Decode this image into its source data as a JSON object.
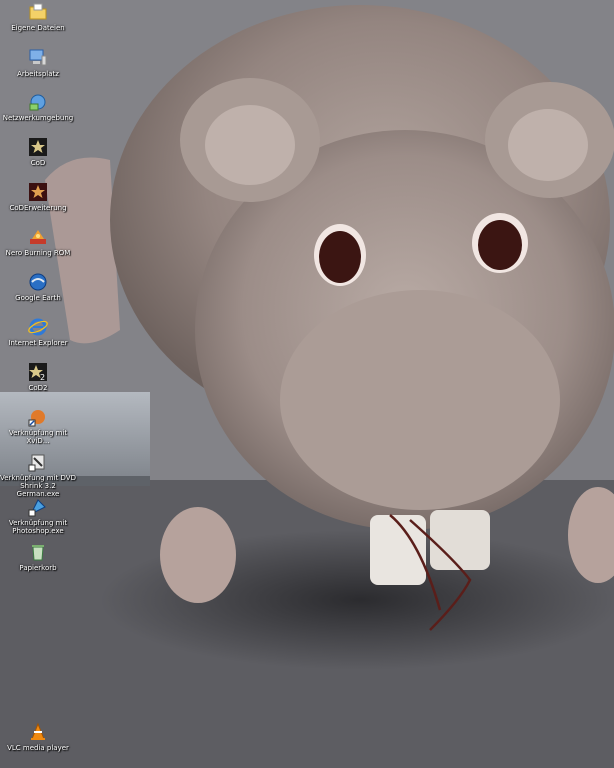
{
  "desktop": {
    "icons": [
      {
        "label": "Eigene Dateien",
        "icon": "folder-documents-icon"
      },
      {
        "label": "Arbeitsplatz",
        "icon": "my-computer-icon"
      },
      {
        "label": "Netzwerkumgebung",
        "icon": "network-icon"
      },
      {
        "label": "CoD",
        "icon": "cod-star-icon"
      },
      {
        "label": "CoDErweiterung",
        "icon": "cod-expansion-icon"
      },
      {
        "label": "Nero Burning ROM",
        "icon": "nero-icon"
      },
      {
        "label": "Google Earth",
        "icon": "google-earth-icon"
      },
      {
        "label": "Internet Explorer",
        "icon": "internet-explorer-icon"
      },
      {
        "label": "CoD2",
        "icon": "cod2-icon"
      },
      {
        "label": "Verknüpfung mit XviD...",
        "icon": "shortcut-app-icon"
      },
      {
        "label": "Verknüpfung mit DVD Shrink 3.2 German.exe",
        "icon": "dvd-shrink-icon"
      },
      {
        "label": "Verknüpfung mit Photoshop.exe",
        "icon": "photoshop-icon"
      },
      {
        "label": "Papierkorb",
        "icon": "recycle-bin-icon"
      },
      {
        "label": "VLC media player",
        "icon": "vlc-icon"
      }
    ]
  },
  "colors": {
    "label_text": "#ffffff",
    "plush_fur": "#9a8b86",
    "shelf": "#9aa0a8"
  }
}
